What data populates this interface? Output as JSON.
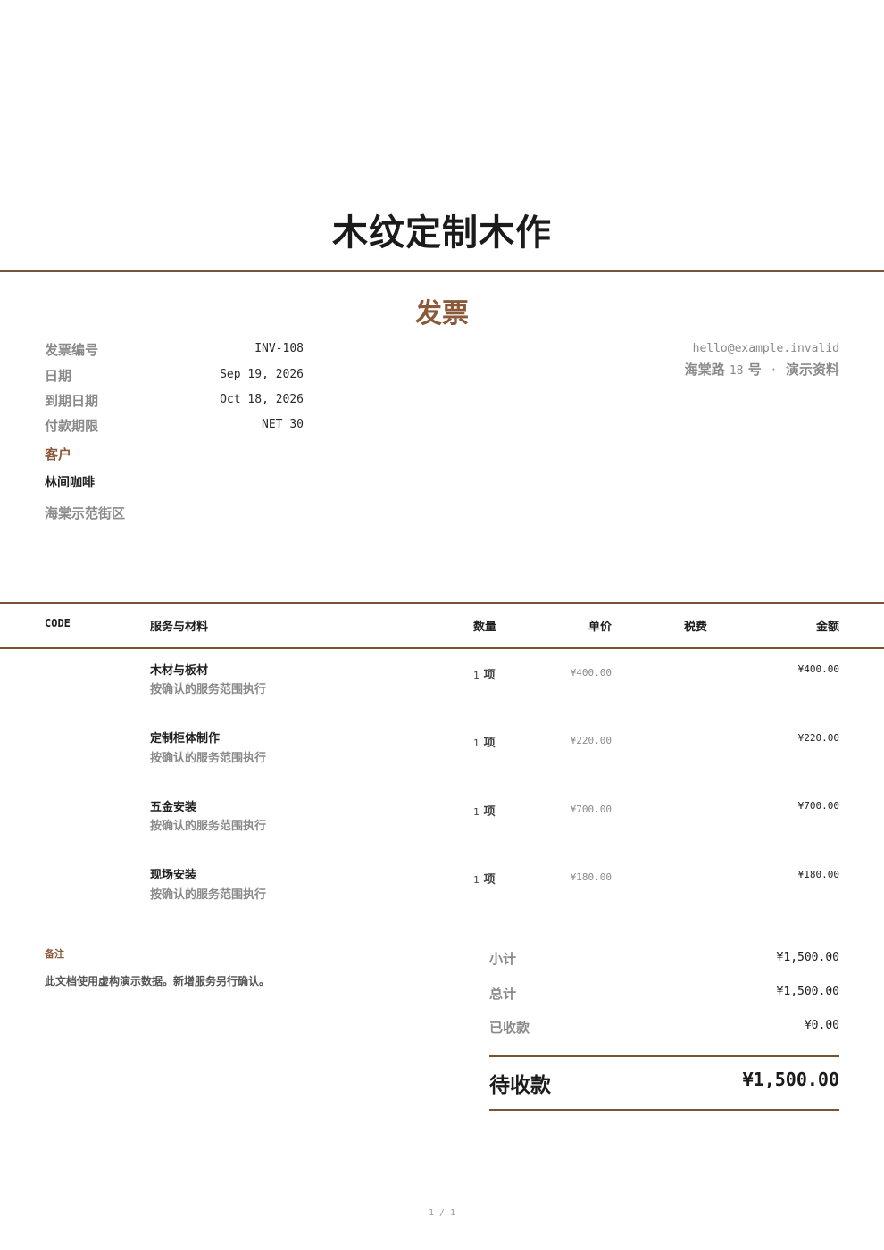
{
  "company": {
    "name": "木纹定制木作"
  },
  "document": {
    "title": "发票"
  },
  "meta": [
    {
      "label": "发票编号",
      "value": "INV-108"
    },
    {
      "label": "日期",
      "value": "Sep 19, 2026"
    },
    {
      "label": "到期日期",
      "value": "Oct 18, 2026"
    },
    {
      "label": "付款期限",
      "value": "NET 30"
    }
  ],
  "client": {
    "section_label": "客户",
    "name": "林间咖啡",
    "address": "海棠示范街区"
  },
  "sender": {
    "email": "hello@example.invalid",
    "street": "海棠路",
    "number": "18",
    "unit": "号",
    "separator": "·",
    "note": "演示资料"
  },
  "table": {
    "headers": {
      "code": "CODE",
      "description": "服务与材料",
      "qty": "数量",
      "price": "单价",
      "tax": "税费",
      "amount": "金额"
    },
    "rows": [
      {
        "code": "",
        "title": "木材与板材",
        "desc": "按确认的服务范围执行",
        "qty": "1",
        "qty_unit": "项",
        "price": "¥400.00",
        "tax": "",
        "amount": "¥400.00"
      },
      {
        "code": "",
        "title": "定制柜体制作",
        "desc": "按确认的服务范围执行",
        "qty": "1",
        "qty_unit": "项",
        "price": "¥220.00",
        "tax": "",
        "amount": "¥220.00"
      },
      {
        "code": "",
        "title": "五金安装",
        "desc": "按确认的服务范围执行",
        "qty": "1",
        "qty_unit": "项",
        "price": "¥700.00",
        "tax": "",
        "amount": "¥700.00"
      },
      {
        "code": "",
        "title": "现场安装",
        "desc": "按确认的服务范围执行",
        "qty": "1",
        "qty_unit": "项",
        "price": "¥180.00",
        "tax": "",
        "amount": "¥180.00"
      }
    ]
  },
  "notes": {
    "label": "备注",
    "text": "此文档使用虚构演示数据。新增服务另行确认。"
  },
  "summary": {
    "subtotal_label": "小计",
    "subtotal": "¥1,500.00",
    "total_label": "总计",
    "total": "¥1,500.00",
    "paid_label": "已收款",
    "paid": "¥0.00",
    "due_label": "待收款",
    "due": "¥1,500.00"
  },
  "footer": {
    "page": "1 / 1"
  },
  "colors": {
    "accent": "#8a5a3a",
    "rule": "#7a5236",
    "muted": "#8a8a8a"
  }
}
